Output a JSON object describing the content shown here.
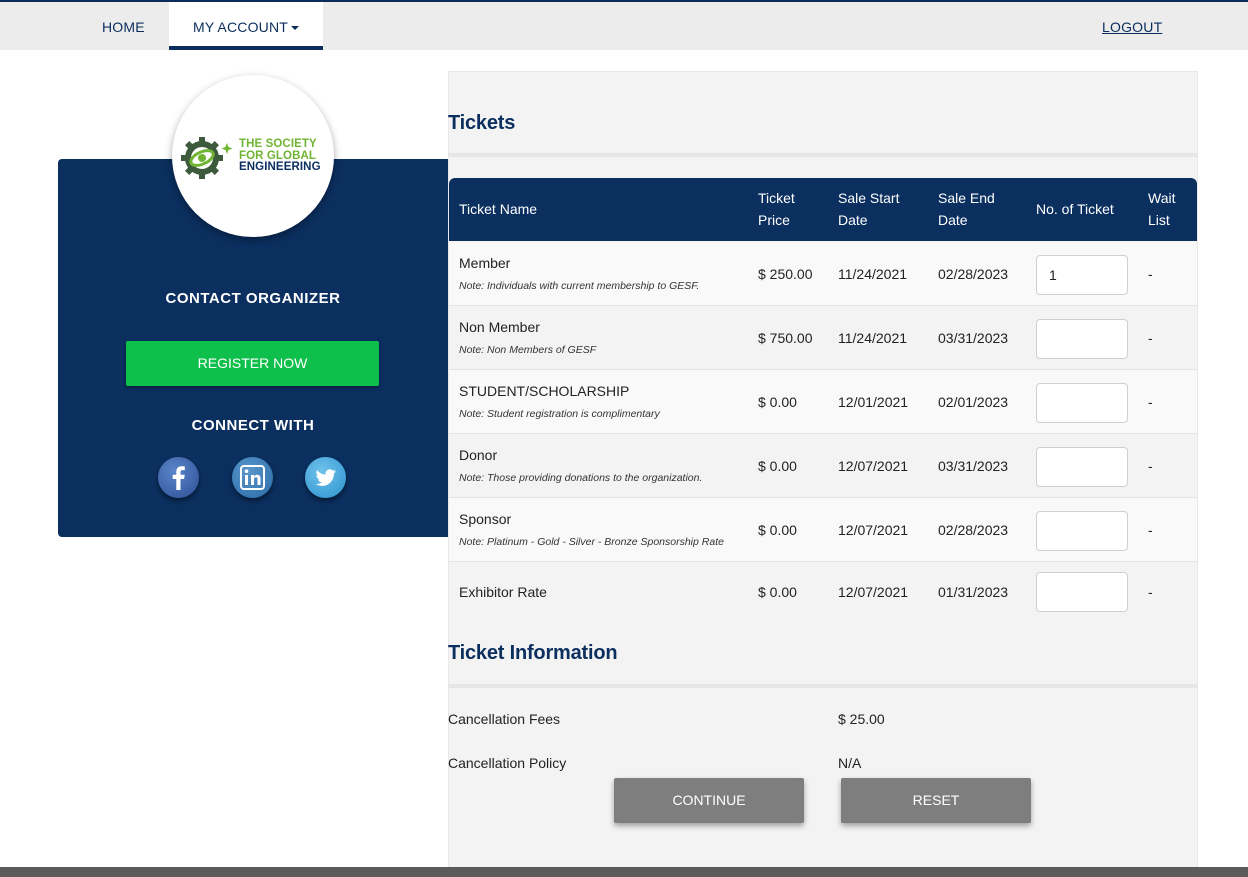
{
  "nav": {
    "home": "HOME",
    "my_account": "MY ACCOUNT",
    "logout": "LOGOUT"
  },
  "sidebar": {
    "logo_line1": "THE SOCIETY",
    "logo_line2": "FOR GLOBAL",
    "logo_line3": "ENGINEERING",
    "contact_organizer": "CONTACT ORGANIZER",
    "register_now": "REGISTER NOW",
    "connect_with": "CONNECT WITH",
    "social_icons": [
      "facebook-icon",
      "linkedin-icon",
      "twitter-icon"
    ]
  },
  "tickets": {
    "title": "Tickets",
    "headers": {
      "name": "Ticket Name",
      "price_1": "Ticket",
      "price_2": "Price",
      "start_1": "Sale Start",
      "start_2": "Date",
      "end_1": "Sale End",
      "end_2": "Date",
      "num": "No. of Ticket",
      "wait_1": "Wait",
      "wait_2": "List"
    },
    "rows": [
      {
        "name": "Member",
        "note": "Note: Individuals with current membership to GESF.",
        "price": "$ 250.00",
        "start": "11/24/2021",
        "end": "02/28/2023",
        "qty": "1",
        "wait": "-"
      },
      {
        "name": "Non Member",
        "note": "Note: Non Members of GESF",
        "price": "$ 750.00",
        "start": "11/24/2021",
        "end": "03/31/2023",
        "qty": "",
        "wait": "-"
      },
      {
        "name": "STUDENT/SCHOLARSHIP",
        "note": "Note: Student registration is complimentary",
        "price": "$ 0.00",
        "start": "12/01/2021",
        "end": "02/01/2023",
        "qty": "",
        "wait": "-"
      },
      {
        "name": "Donor",
        "note": "Note: Those providing donations to the organization.",
        "price": "$ 0.00",
        "start": "12/07/2021",
        "end": "03/31/2023",
        "qty": "",
        "wait": "-"
      },
      {
        "name": "Sponsor",
        "note": "Note: Platinum - Gold - Silver - Bronze Sponsorship Rate",
        "price": "$ 0.00",
        "start": "12/07/2021",
        "end": "02/28/2023",
        "qty": "",
        "wait": "-"
      },
      {
        "name": "Exhibitor Rate",
        "note": "",
        "price": "$ 0.00",
        "start": "12/07/2021",
        "end": "01/31/2023",
        "qty": "",
        "wait": "-"
      }
    ]
  },
  "ticket_info": {
    "title": "Ticket Information",
    "cancellation_fees_label": "Cancellation Fees",
    "cancellation_fees_value": "$ 25.00",
    "cancellation_policy_label": "Cancellation Policy",
    "cancellation_policy_value": "N/A"
  },
  "actions": {
    "continue": "CONTINUE",
    "reset": "RESET"
  },
  "colors": {
    "navy": "#0b2f5f",
    "green_button": "#0fbf4b",
    "gray_button": "#7e7e7e",
    "logo_green": "#6fb432"
  }
}
